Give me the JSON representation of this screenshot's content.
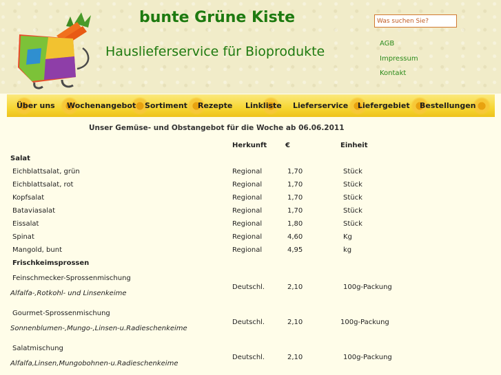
{
  "header": {
    "title": "bunte Grüne Kiste",
    "subtitle": "Hauslieferservice für Bioprodukte",
    "search_placeholder": "Was suchen Sie?",
    "links": [
      "AGB",
      "Impressum",
      "Kontakt"
    ]
  },
  "nav": [
    "Über uns",
    "Wochenangebot",
    "Sortiment",
    "Rezepte",
    "Linkliste",
    "Lieferservice",
    "Liefergebiet",
    "Bestellungen"
  ],
  "offer": {
    "heading": "Unser Gemüse- und Obstangebot für die Woche ab 06.06.2011",
    "columns": {
      "origin": "Herkunft",
      "price": "€",
      "unit": "Einheit"
    },
    "sections": [
      {
        "name": "Salat",
        "items": [
          {
            "name": "Eichblattsalat, grün",
            "origin": "Regional",
            "price": "1,70",
            "unit": "Stück"
          },
          {
            "name": "Eichblattsalat, rot",
            "origin": "Regional",
            "price": "1,70",
            "unit": "Stück"
          },
          {
            "name": "Kopfsalat",
            "origin": "Regional",
            "price": "1,70",
            "unit": "Stück"
          },
          {
            "name": "Bataviasalat",
            "origin": "Regional",
            "price": "1,70",
            "unit": "Stück"
          },
          {
            "name": "Eissalat",
            "origin": "Regional",
            "price": "1,80",
            "unit": "Stück"
          },
          {
            "name": "Spinat",
            "origin": "Regional",
            "price": "4,60",
            "unit": "Kg"
          },
          {
            "name": "Mangold, bunt",
            "origin": "Regional",
            "price": "4,95",
            "unit": "kg"
          }
        ]
      },
      {
        "name": "Frischkeimsprossen",
        "items": [
          {
            "name": "Feinschmecker-Sprossenmischung",
            "desc": "Alfalfa-,Rotkohl- und Linsenkeime",
            "origin": "Deutschl.",
            "price": "2,10",
            "unit": "100g-Packung"
          },
          {
            "name": "Gourmet-Sprossenmischung",
            "desc": "Sonnenblumen-,Mungo-,Linsen-u.Radieschenkeime",
            "origin": "Deutschl.",
            "price": "2,10",
            "unit": "100g-Packung"
          },
          {
            "name": "Salatmischung",
            "desc": "Alfalfa,Linsen,Mungobohnen-u.Radieschenkeime",
            "origin": "Deutschl.",
            "price": "2,10",
            "unit": "100g-Packung"
          }
        ]
      }
    ]
  }
}
